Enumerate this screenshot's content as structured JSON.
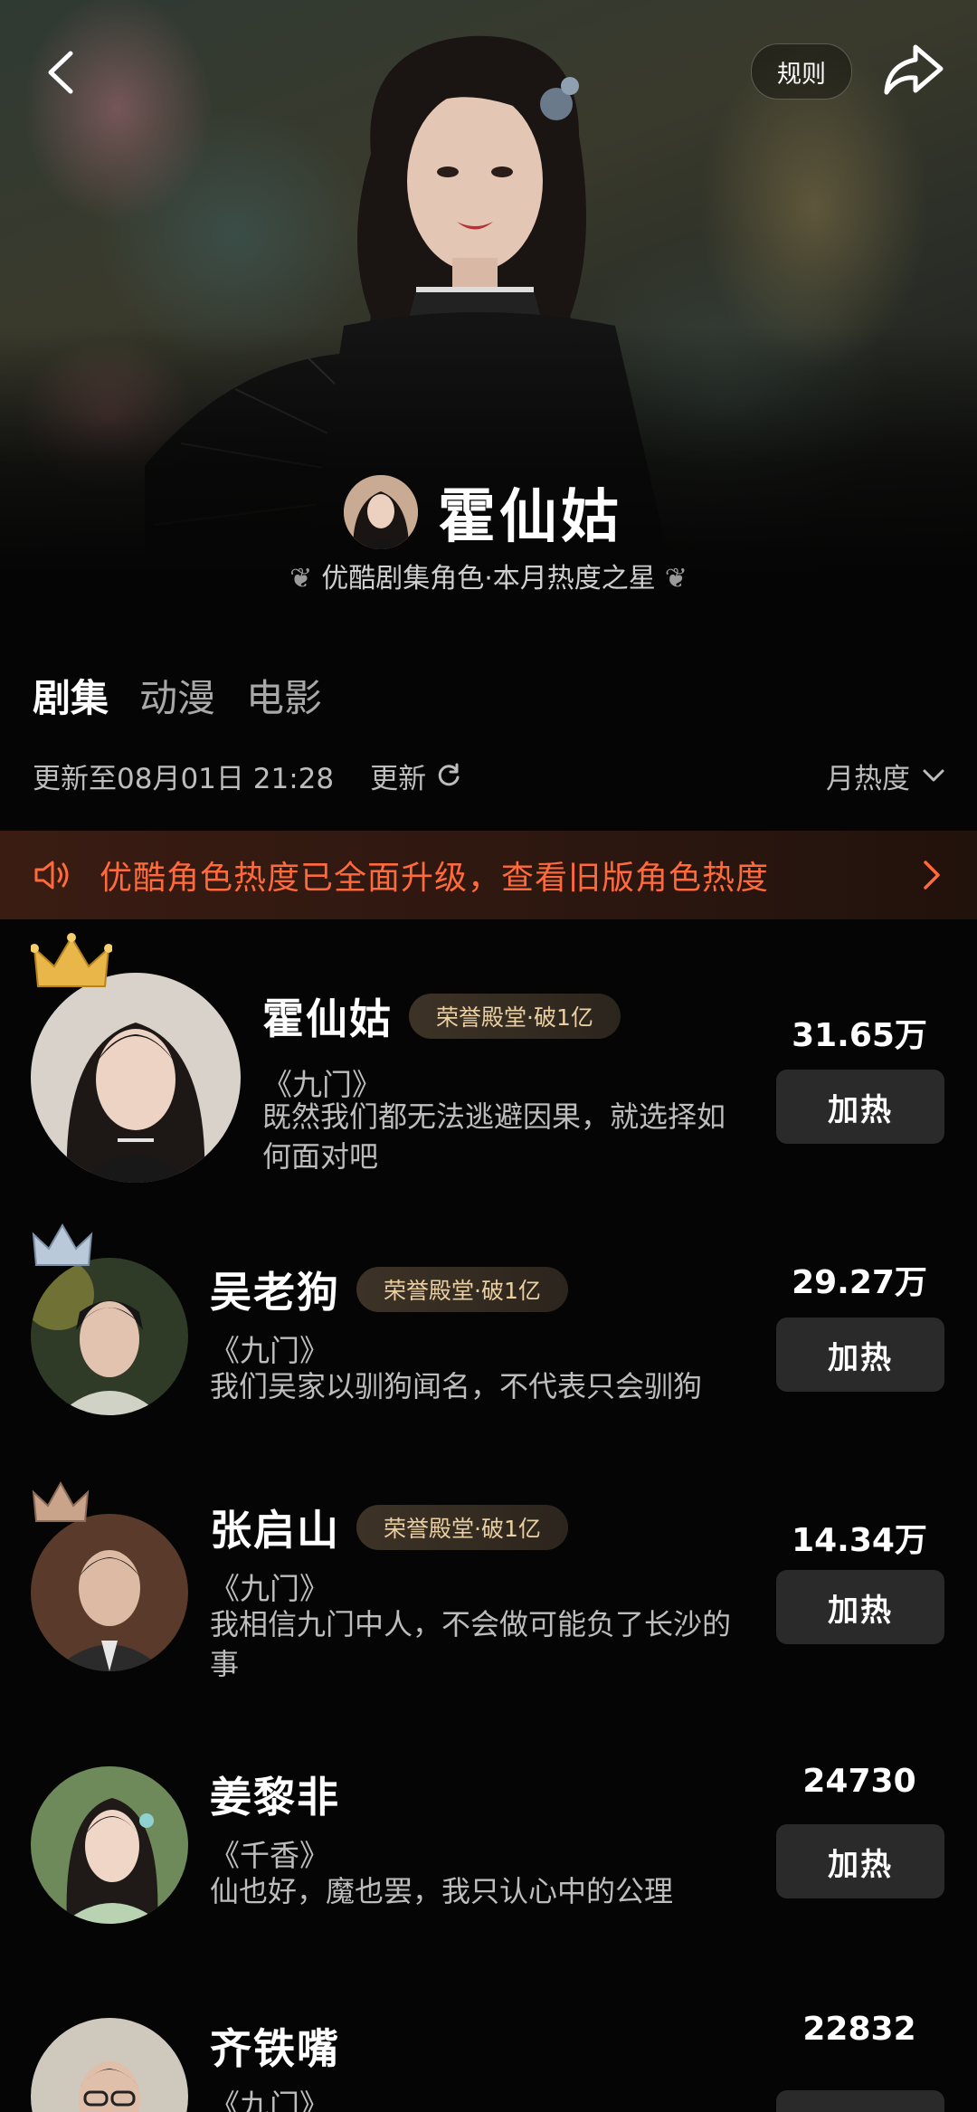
{
  "header": {
    "rules_label": "规则",
    "character_name": "霍仙姑",
    "subtitle": "优酷剧集角色·本月热度之星"
  },
  "tabs": [
    {
      "label": "剧集",
      "active": true
    },
    {
      "label": "动漫",
      "active": false
    },
    {
      "label": "电影",
      "active": false
    }
  ],
  "update": {
    "text": "更新至08月01日 21:28",
    "refresh_label": "更新",
    "sort_label": "月热度"
  },
  "banner": {
    "text": "优酷角色热度已全面升级，查看旧版角色热度"
  },
  "colors": {
    "accent": "#ff6a3c",
    "badge_text": "#e9cfa2",
    "crown_gold": "#e9b64a",
    "crown_silver": "#b9c9da",
    "crown_bronze": "#c9a38a"
  },
  "rankings": [
    {
      "rank": 1,
      "name": "霍仙姑",
      "badge": "荣誉殿堂·破1亿",
      "show": "《九门》",
      "quote": "既然我们都无法逃避因果，就选择如何面对吧",
      "score": "31.65万",
      "button": "加热",
      "crown": "gold-crown-icon"
    },
    {
      "rank": 2,
      "name": "吴老狗",
      "badge": "荣誉殿堂·破1亿",
      "show": "《九门》",
      "quote": "我们吴家以驯狗闻名，不代表只会驯狗",
      "score": "29.27万",
      "button": "加热",
      "crown": "silver-crown-icon"
    },
    {
      "rank": 3,
      "name": "张启山",
      "badge": "荣誉殿堂·破1亿",
      "show": "《九门》",
      "quote": "我相信九门中人，不会做可能负了长沙的事",
      "score": "14.34万",
      "button": "加热",
      "crown": "bronze-crown-icon"
    },
    {
      "rank": 4,
      "name": "姜黎非",
      "badge": "",
      "show": "《千香》",
      "quote": "仙也好，魔也罢，我只认心中的公理",
      "score": "24730",
      "button": "加热",
      "crown": ""
    },
    {
      "rank": 5,
      "name": "齐铁嘴",
      "badge": "",
      "show": "《九门》",
      "quote": "",
      "score": "22832",
      "button": "加热",
      "crown": ""
    }
  ]
}
